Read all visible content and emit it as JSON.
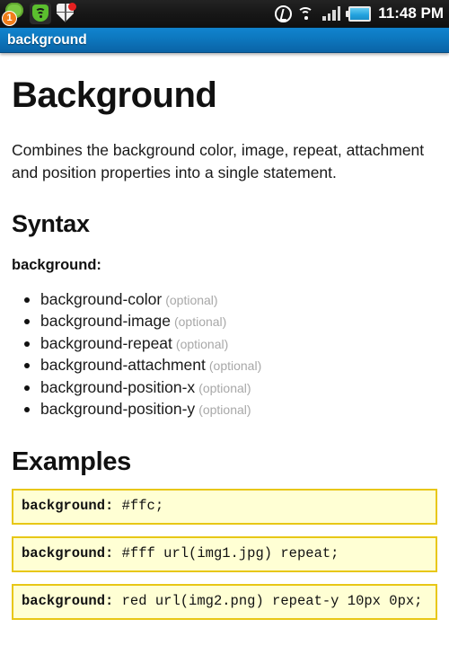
{
  "status_bar": {
    "left_icons": [
      {
        "name": "message-icon",
        "badge": "1"
      },
      {
        "name": "wifi-shield-icon"
      },
      {
        "name": "security-shield-icon"
      }
    ],
    "right_icons": [
      {
        "name": "sync-icon"
      },
      {
        "name": "wifi-icon"
      },
      {
        "name": "signal-bars-icon"
      },
      {
        "name": "battery-icon"
      }
    ],
    "clock": "11:48 PM"
  },
  "title_bar": {
    "title": "background"
  },
  "page": {
    "heading": "Background",
    "intro": "Combines the background color, image, repeat, attachment and position properties into a single statement.",
    "syntax": {
      "section_title": "Syntax",
      "label": "background:",
      "properties": [
        {
          "name": "background-color",
          "note": "(optional)"
        },
        {
          "name": "background-image",
          "note": "(optional)"
        },
        {
          "name": "background-repeat",
          "note": "(optional)"
        },
        {
          "name": "background-attachment",
          "note": "(optional)"
        },
        {
          "name": "background-position-x",
          "note": "(optional)"
        },
        {
          "name": "background-position-y",
          "note": "(optional)"
        }
      ]
    },
    "examples": {
      "section_title": "Examples",
      "items": [
        {
          "property": "background:",
          "value": " #ffc;"
        },
        {
          "property": "background:",
          "value": " #fff url(img1.jpg) repeat;"
        },
        {
          "property": "background:",
          "value": " red url(img2.png) repeat-y 10px 0px;"
        }
      ]
    }
  },
  "colors": {
    "title_bar_blue": "#0d79c0",
    "code_bg": "#ffffd4",
    "code_border": "#e8c716",
    "optional_gray": "#a8a8a8",
    "battery_blue": "#2ea8e0"
  }
}
